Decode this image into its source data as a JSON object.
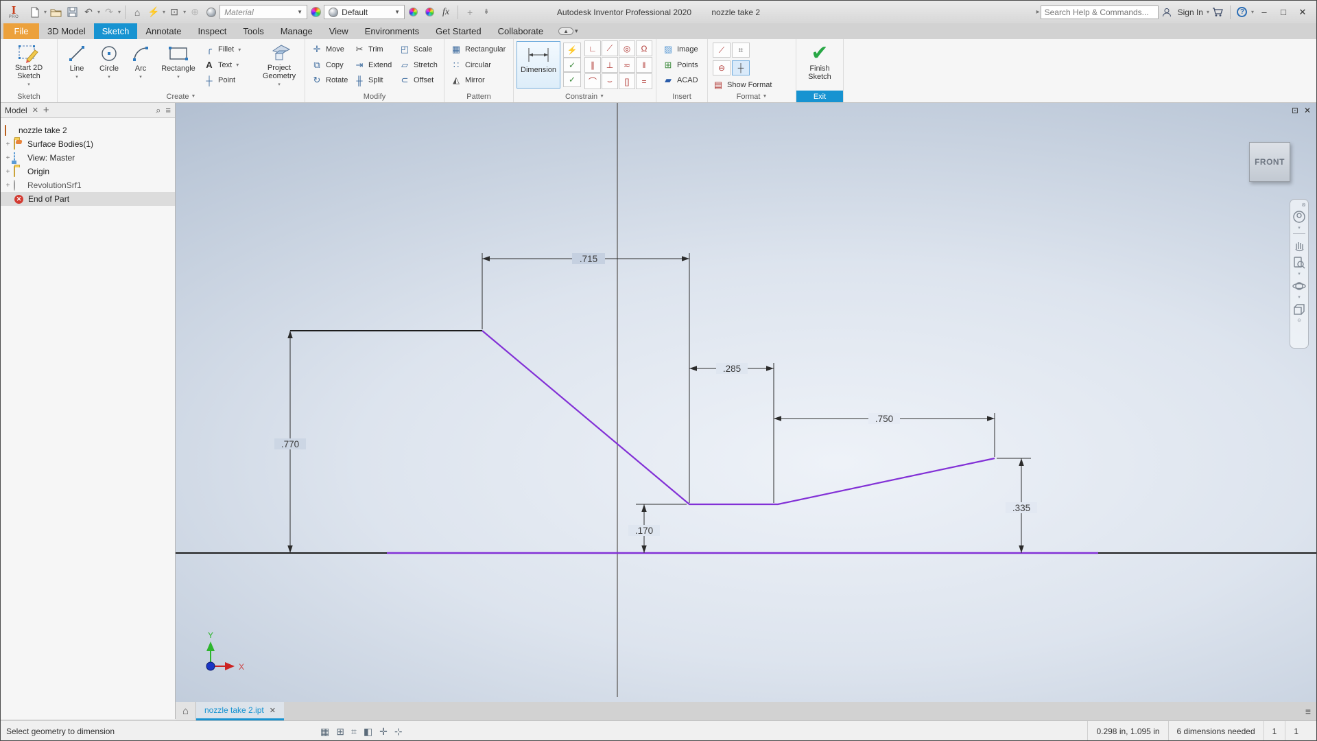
{
  "titlebar": {
    "app_title": "Autodesk Inventor Professional 2020",
    "doc_title": "nozzle take 2",
    "material_value": "Material",
    "appearance_value": "Default",
    "fx_label": "fx",
    "search_placeholder": "Search Help & Commands...",
    "sign_in_label": "Sign In",
    "help_glyph": "?",
    "logo_letter": "I",
    "logo_sub": "PRO",
    "minimize_glyph": "–",
    "maximize_glyph": "□",
    "close_glyph": "✕"
  },
  "tabs": {
    "items": [
      "File",
      "3D Model",
      "Sketch",
      "Annotate",
      "Inspect",
      "Tools",
      "Manage",
      "View",
      "Environments",
      "Get Started",
      "Collaborate"
    ]
  },
  "ribbon": {
    "sketch": {
      "label": "Sketch",
      "start2d": "Start 2D Sketch"
    },
    "create": {
      "label": "Create",
      "line": "Line",
      "circle": "Circle",
      "arc": "Arc",
      "rect": "Rectangle",
      "fillet": "Fillet",
      "text": "Text",
      "point": "Point",
      "project": "Project Geometry"
    },
    "modify": {
      "label": "Modify",
      "move": "Move",
      "copy": "Copy",
      "rotate": "Rotate",
      "trim": "Trim",
      "extend": "Extend",
      "split": "Split",
      "scale": "Scale",
      "stretch": "Stretch",
      "offset": "Offset",
      "glyphs": {
        "move": "✛",
        "copy": "⧉",
        "rotate": "↻",
        "trim": "✂",
        "extend": "⇥",
        "split": "╫",
        "scale": "◰",
        "stretch": "▱",
        "offset": "⊂"
      }
    },
    "pattern": {
      "label": "Pattern",
      "rectangular": "Rectangular",
      "circular": "Circular",
      "mirror": "Mirror",
      "glyphs": {
        "rectangular": "▦",
        "circular": "∷",
        "mirror": "◭"
      }
    },
    "constrain": {
      "label": "Constrain",
      "dimension": "Dimension",
      "tools": [
        {
          "glyph": "⚡"
        },
        {
          "glyph": "✓"
        },
        {
          "glyph": "✓"
        }
      ],
      "grid": [
        {
          "glyph": "∟"
        },
        {
          "glyph": "⟋"
        },
        {
          "glyph": "◎"
        },
        {
          "glyph": "Ω"
        },
        {
          "glyph": "∥"
        },
        {
          "glyph": "⊥"
        },
        {
          "glyph": "≂"
        },
        {
          "glyph": "‖"
        },
        {
          "glyph": "⌒"
        },
        {
          "glyph": "⌣"
        },
        {
          "glyph": "[]"
        },
        {
          "glyph": "="
        }
      ]
    },
    "insert": {
      "label": "Insert",
      "image": "Image",
      "points": "Points",
      "acad": "ACAD",
      "glyphs": {
        "image": "▨",
        "points": "⊞",
        "acad": "▰"
      }
    },
    "format": {
      "label": "Format",
      "show_format": "Show Format",
      "glyphs": {
        "construction": "⟋",
        "driven": "⌗",
        "centerline": "⊖",
        "centerpoint": "┼",
        "show": "▤"
      }
    },
    "exit": {
      "label": "Exit",
      "finish": "Finish Sketch"
    }
  },
  "browser": {
    "tab_label": "Model",
    "close_glyph": "✕",
    "add_glyph": "+",
    "search_glyph": "⌕",
    "menu_glyph": "≡",
    "items": [
      "nozzle take 2",
      "Surface Bodies(1)",
      "View: Master",
      "Origin",
      "RevolutionSrf1",
      "End of Part"
    ]
  },
  "canvas": {
    "viewcube_label": "FRONT",
    "dims": {
      "d715": ".715",
      "d285": ".285",
      "d750": ".750",
      "d770": ".770",
      "d170": ".170",
      "d335": ".335"
    },
    "axis_x_label": "X",
    "axis_y_label": "Y",
    "colors": {
      "sketch_purple": "#8230d6",
      "accent_blue": "#1793d1"
    }
  },
  "doctab": {
    "file_name": "nozzle take 2.ipt",
    "close_glyph": "✕",
    "home_glyph": "⌂"
  },
  "statusbar": {
    "message": "Select geometry to dimension",
    "icon_glyphs": [
      "▦",
      "⊞",
      "⌗",
      "◧",
      "✛",
      "⊹"
    ],
    "coords": "0.298 in, 1.095 in",
    "needed": "6 dimensions needed",
    "count1": "1",
    "count2": "1"
  }
}
